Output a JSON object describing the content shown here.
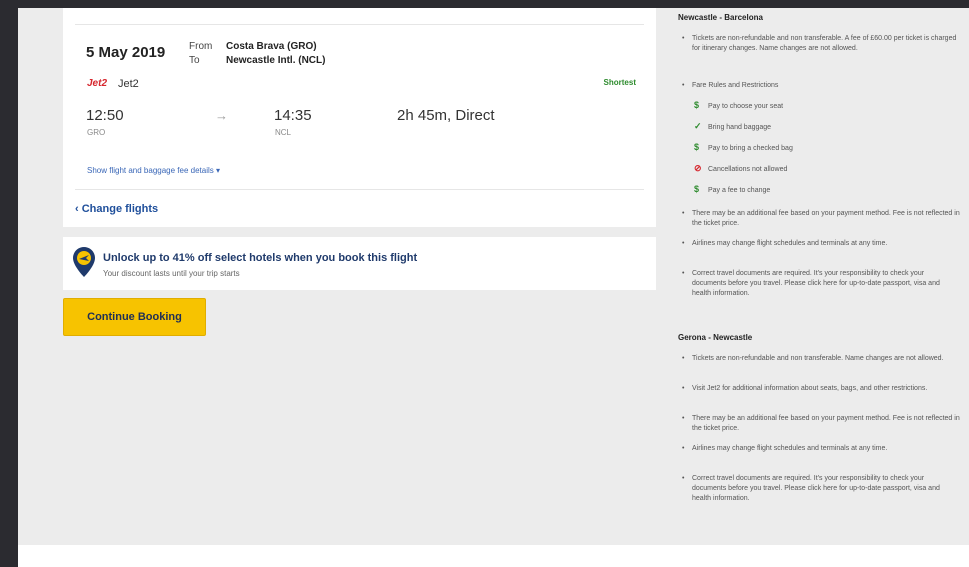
{
  "flight": {
    "date": "5 May 2019",
    "from_label": "From",
    "to_label": "To",
    "from": "Costa Brava (GRO)",
    "to": "Newcastle Intl. (NCL)",
    "airline_logo_text": "Jet2",
    "airline": "Jet2",
    "badge": "Shortest",
    "departure_time": "12:50",
    "departure_code": "GRO",
    "arrival_time": "14:35",
    "arrival_code": "NCL",
    "duration": "2h 45m, Direct",
    "details_link": "Show flight and baggage fee details ▾",
    "change_flights": "‹ Change flights"
  },
  "banner": {
    "title": "Unlock up to 41% off select hotels when you book this flight",
    "subtitle": "Your discount lasts until your trip starts"
  },
  "continue_button": "Continue Booking",
  "rules": {
    "section1": {
      "title": "Newcastle - Barcelona",
      "b1": "Tickets are non-refundable and non transferable. A fee of £60.00 per ticket is charged for itinerary changes. Name changes are not allowed.",
      "b2": "Fare Rules and Restrictions",
      "items": [
        "Pay to choose your seat",
        "Bring hand baggage",
        "Pay to bring a checked bag",
        "Cancellations not allowed",
        "Pay a fee to change"
      ],
      "b3": "There may be an additional fee based on your payment method. Fee is not reflected in the ticket price.",
      "b4": "Airlines may change flight schedules and terminals at any time.",
      "b5": "Correct travel documents are required. It's your responsibility to check your documents before you travel. Please click here for up-to-date passport, visa and health information."
    },
    "section2": {
      "title": "Gerona - Newcastle",
      "b1": "Tickets are non-refundable and non transferable. Name changes are not allowed.",
      "b2": "Visit Jet2 for additional information about seats, bags, and other restrictions.",
      "b3": "There may be an additional fee based on your payment method. Fee is not reflected in the ticket price.",
      "b4": "Airlines may change flight schedules and terminals at any time.",
      "b5": "Correct travel documents are required. It's your responsibility to check your documents before you travel. Please click here for up-to-date passport, visa and health information."
    }
  }
}
